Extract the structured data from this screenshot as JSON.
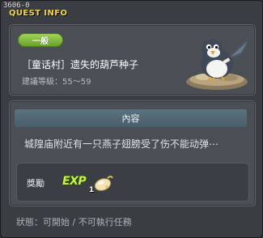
{
  "window": {
    "id": "3606-0",
    "title": "QUEST INFO"
  },
  "quest": {
    "difficulty": "一般",
    "title": "［童话村］遗失的葫芦种子",
    "level": "建議等級：55～59"
  },
  "content": {
    "header": "內容",
    "description": "城隍庙附近有一只燕子翅膀受了伤不能动弹⋯",
    "reward_label": "獎勵",
    "reward_exp_text": "EXP",
    "reward_count": "1"
  },
  "status": "狀態：可開始 / 不可執行任務",
  "colors": {
    "title": "#f3d54b",
    "badge": "#8cc43f",
    "section_header": "#526a76"
  }
}
